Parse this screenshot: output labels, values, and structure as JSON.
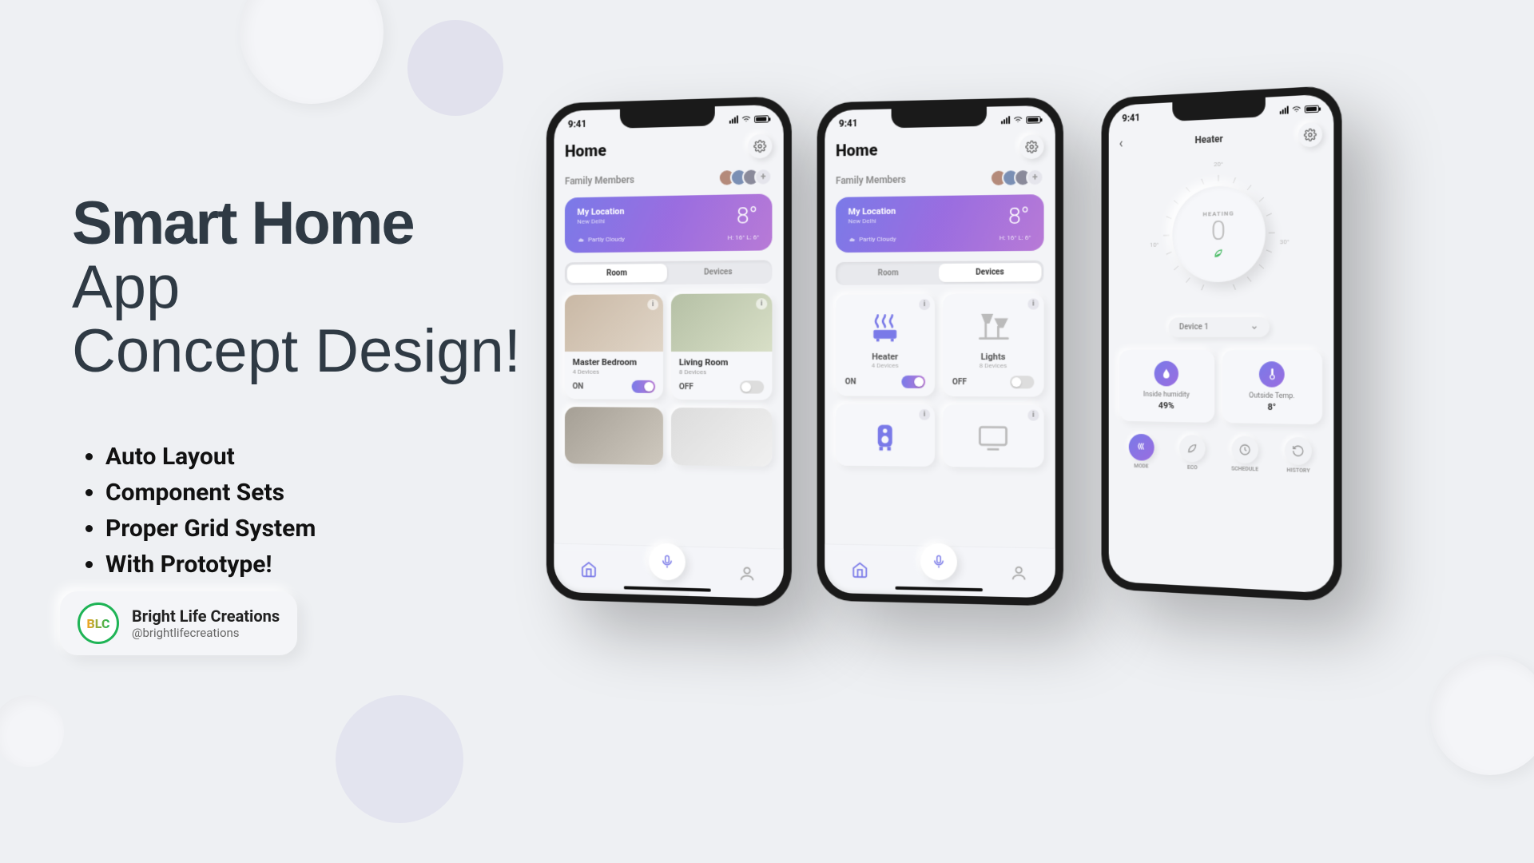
{
  "headline": {
    "bold": "Smart Home",
    "light_line1": "App",
    "light_line2": "Concept Design!"
  },
  "features": [
    "Auto Layout",
    "Component Sets",
    "Proper Grid System",
    "With Prototype!"
  ],
  "brand": {
    "logo": "BLC",
    "name": "Bright Life Creations",
    "handle": "@brightlifecreations"
  },
  "phone_common": {
    "time": "9:41",
    "home_title": "Home",
    "family_label": "Family Members",
    "weather": {
      "loc_label": "My Location",
      "city": "New Delhi",
      "temp": "8°",
      "condition": "Partly Cloudy",
      "hilo": "H: 16° L: 6°"
    },
    "tabs": {
      "room": "Room",
      "devices": "Devices"
    }
  },
  "phone1": {
    "rooms": [
      {
        "name": "Master Bedroom",
        "sub": "4 Devices",
        "state": "ON",
        "on": true
      },
      {
        "name": "Living Room",
        "sub": "8 Devices",
        "state": "OFF",
        "on": false
      }
    ]
  },
  "phone2": {
    "devices": [
      {
        "name": "Heater",
        "sub": "4 Devices",
        "state": "ON",
        "on": true,
        "icon": "heater"
      },
      {
        "name": "Lights",
        "sub": "8 Devices",
        "state": "OFF",
        "on": false,
        "icon": "lamp"
      }
    ]
  },
  "phone3": {
    "title": "Heater",
    "dial": {
      "label": "HEATING",
      "value": "0",
      "mark_top": "20°",
      "mark_left": "10°",
      "mark_right": "30°"
    },
    "device_select": "Device 1",
    "stats": [
      {
        "label": "Inside humidity",
        "value": "49%"
      },
      {
        "label": "Outside Temp.",
        "value": "8°"
      }
    ],
    "modes": [
      "MODE",
      "ECO",
      "SCHEDULE",
      "HISTORY"
    ]
  }
}
